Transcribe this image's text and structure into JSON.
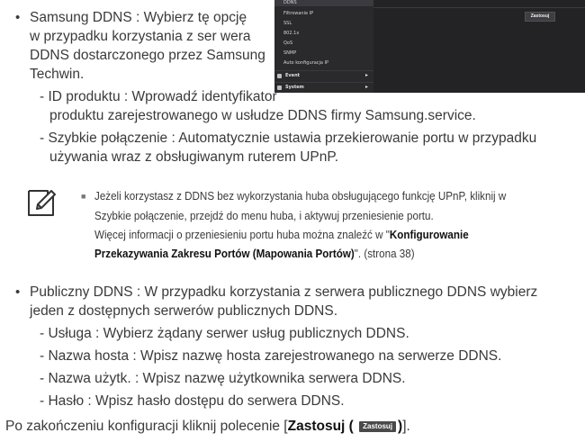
{
  "screenshot": {
    "menu_items": [
      "DDNS",
      "Filtrowanie IP",
      "SSL",
      "802.1x",
      "QoS",
      "SNMP",
      "Auto konfiguracja IP"
    ],
    "groups": [
      {
        "label": "Event",
        "icon": "event-icon"
      },
      {
        "label": "System",
        "icon": "system-icon"
      }
    ],
    "apply_button": "Zastosuj"
  },
  "samsung_ddns": {
    "bullet": "•",
    "line1": "Samsung DDNS : Wybierz tę opcję",
    "line2": "w przypadku korzystania z ser wera",
    "line3": "DDNS dostarczonego przez Samsung",
    "line4": "Techwin.",
    "sub1_line1": "- ID produktu : Wprowadź identyfikator",
    "sub1_line2": "produktu zarejestrowanego w usłudze DDNS firmy Samsung.service.",
    "sub2_line1": "- Szybkie połączenie : Automatycznie ustawia przekierowanie portu w przypadku",
    "sub2_line2": "używania wraz z obsługiwanym ruterem UPnP."
  },
  "note": {
    "icon": "note-pencil-icon",
    "marker": "■",
    "line1": "Jeżeli korzystasz z DDNS bez wykorzystania huba obsługującego funkcję UPnP, kliknij w",
    "line2": "Szybkie połączenie, przejdź do menu huba, i aktywuj przeniesienie portu.",
    "line3": "Więcej informacji o przeniesieniu portu huba można znaleźć w \"",
    "line3_bold": "Konfigurowanie",
    "line4_bold": "Przekazywania Zakresu Portów (Mapowania Portów)",
    "line4_end": "\". (strona 38)"
  },
  "public_ddns": {
    "bullet": "•",
    "line1": "Publiczny DDNS : W przypadku korzystania z serwera publicznego DDNS wybierz",
    "line2": "jeden z dostępnych serwerów publicznych DDNS.",
    "items": [
      "- Usługa : Wybierz żądany serwer usług publicznych DDNS.",
      "- Nazwa hosta : Wpisz nazwę hosta zarejestrowanego na serwerze DDNS.",
      "- Nazwa użytk. : Wpisz nazwę użytkownika serwera DDNS.",
      "- Hasło : Wpisz hasło dostępu do serwera DDNS."
    ]
  },
  "final": {
    "prefix": "Po zakończeniu konfiguracji kliknij polecenie [",
    "bold": "Zastosuj (",
    "button": "Zastosuj",
    "bold_end": ")",
    "suffix": "]."
  }
}
